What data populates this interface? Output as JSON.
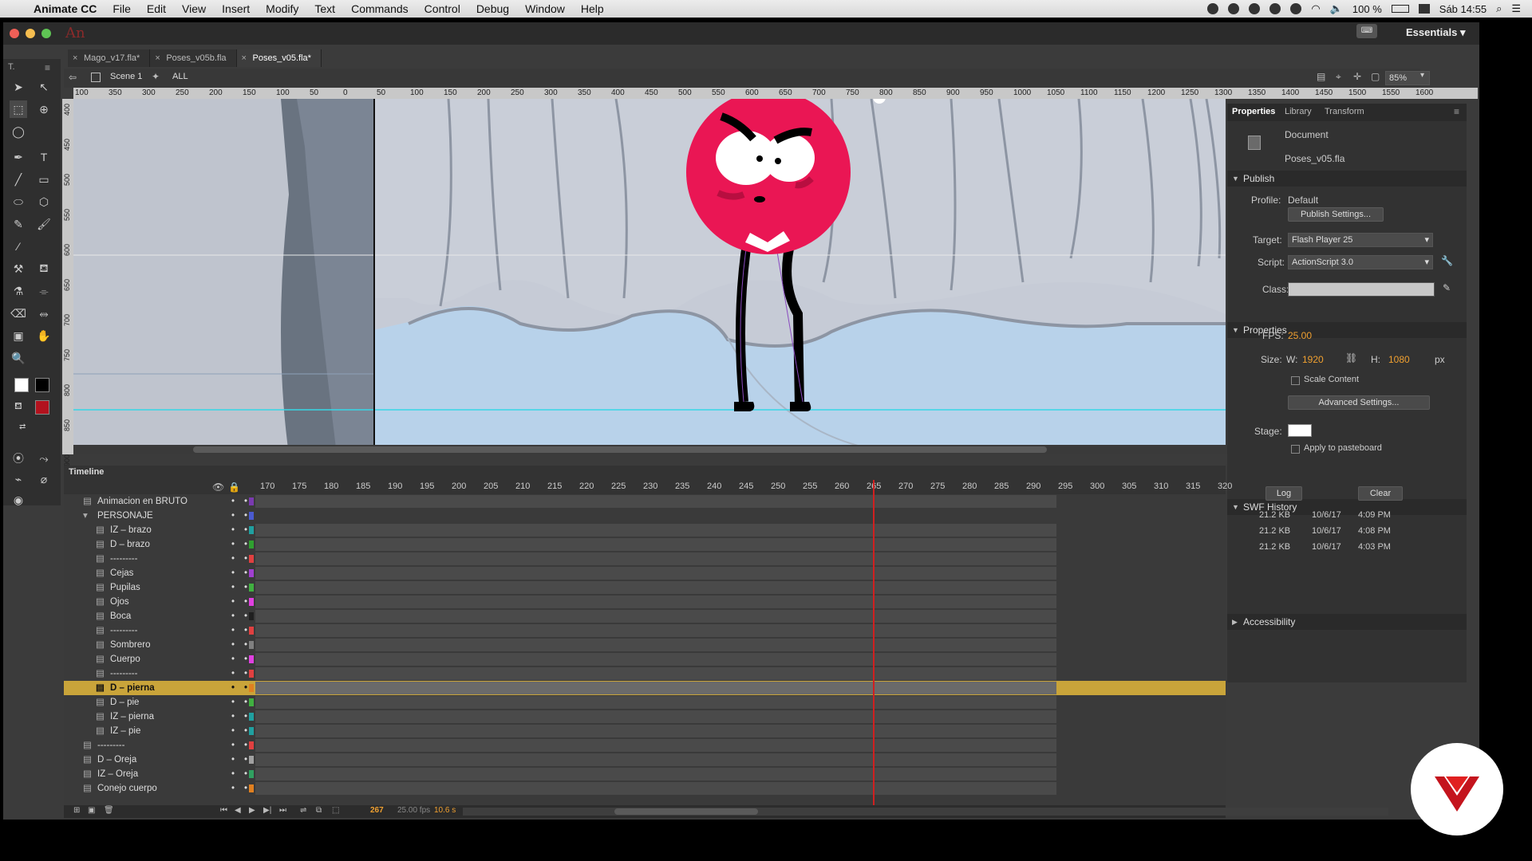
{
  "menubar": {
    "apple": "",
    "app": "Animate CC",
    "items": [
      "File",
      "Edit",
      "View",
      "Insert",
      "Modify",
      "Text",
      "Commands",
      "Control",
      "Debug",
      "Window",
      "Help"
    ],
    "battery": "100 %",
    "clock": "Sáb 14:55"
  },
  "window": {
    "app_logo": "An",
    "workspace": "Essentials",
    "tabs": [
      {
        "label": "Mago_v17.fla*",
        "active": false
      },
      {
        "label": "Poses_v05b.fla",
        "active": false
      },
      {
        "label": "Poses_v05.fla*",
        "active": true
      }
    ],
    "scene": "Scene 1",
    "symbol": "ALL",
    "zoom": "85%"
  },
  "ruler": {
    "top_ticks": [
      "100",
      "350",
      "300",
      "250",
      "200",
      "150",
      "100",
      "50",
      "0",
      "50",
      "100",
      "150",
      "200",
      "250",
      "300",
      "350",
      "400",
      "450",
      "500",
      "550",
      "600",
      "650",
      "700",
      "750",
      "800",
      "850",
      "900",
      "950",
      "1000",
      "1050",
      "1100",
      "1150",
      "1200",
      "1250",
      "1300",
      "1350",
      "1400",
      "1450",
      "1500",
      "1550",
      "1600"
    ],
    "left_ticks": [
      "400",
      "450",
      "500",
      "550",
      "600",
      "650",
      "700",
      "750",
      "800",
      "850",
      "900"
    ]
  },
  "properties": {
    "tabs": [
      "Properties",
      "Library",
      "Transform"
    ],
    "doc_label": "Document",
    "doc_name": "Poses_v05.fla",
    "publish_header": "Publish",
    "profile_label": "Profile:",
    "profile_value": "Default",
    "publish_settings_btn": "Publish Settings...",
    "target_label": "Target:",
    "target_value": "Flash Player 25",
    "script_label": "Script:",
    "script_value": "ActionScript 3.0",
    "class_label": "Class:",
    "props_header": "Properties",
    "fps_label": "FPS:",
    "fps_value": "25.00",
    "size_label": "Size:",
    "w_label": "W:",
    "w_value": "1920",
    "h_label": "H:",
    "h_value": "1080",
    "px": "px",
    "scale_content": "Scale Content",
    "advanced_btn": "Advanced Settings...",
    "stage_label": "Stage:",
    "apply_paste": "Apply to pasteboard",
    "swf_header": "SWF History",
    "log_btn": "Log",
    "clear_btn": "Clear",
    "history": [
      {
        "size": "21.2 KB",
        "date": "10/6/17",
        "time": "4:09 PM"
      },
      {
        "size": "21.2 KB",
        "date": "10/6/17",
        "time": "4:08 PM"
      },
      {
        "size": "21.2 KB",
        "date": "10/6/17",
        "time": "4:03 PM"
      }
    ],
    "accessibility_header": "Accessibility"
  },
  "timeline": {
    "title": "Timeline",
    "frame_numbers": [
      "170",
      "175",
      "180",
      "185",
      "190",
      "195",
      "200",
      "205",
      "210",
      "215",
      "220",
      "225",
      "230",
      "235",
      "240",
      "245",
      "250",
      "255",
      "260",
      "265",
      "270",
      "275",
      "280",
      "285",
      "290",
      "295",
      "300",
      "305",
      "310",
      "315",
      "320"
    ],
    "layers": [
      {
        "name": "Animacion en BRUTO",
        "indent": 0,
        "color": "#7a3ab0",
        "selected": false
      },
      {
        "name": "PERSONAJE",
        "indent": 0,
        "color": "#4a5ad0",
        "selected": false,
        "folder": true
      },
      {
        "name": "IZ – brazo",
        "indent": 1,
        "color": "#20a0a0",
        "selected": false
      },
      {
        "name": "D – brazo",
        "indent": 1,
        "color": "#30a030",
        "selected": false
      },
      {
        "name": "---------",
        "indent": 1,
        "color": "#e04040",
        "selected": false
      },
      {
        "name": "Cejas",
        "indent": 1,
        "color": "#a040d0",
        "selected": false
      },
      {
        "name": "Pupilas",
        "indent": 1,
        "color": "#40b040",
        "selected": false
      },
      {
        "name": "Ojos",
        "indent": 1,
        "color": "#e040e0",
        "selected": false
      },
      {
        "name": "Boca",
        "indent": 1,
        "color": "#202020",
        "selected": false
      },
      {
        "name": "---------",
        "indent": 1,
        "color": "#e04040",
        "selected": false
      },
      {
        "name": "Sombrero",
        "indent": 1,
        "color": "#808080",
        "selected": false
      },
      {
        "name": "Cuerpo",
        "indent": 1,
        "color": "#e040e0",
        "selected": false
      },
      {
        "name": "---------",
        "indent": 1,
        "color": "#e04040",
        "selected": false
      },
      {
        "name": "D – pierna",
        "indent": 1,
        "color": "#e08020",
        "selected": true
      },
      {
        "name": "D – pie",
        "indent": 1,
        "color": "#40b040",
        "selected": false
      },
      {
        "name": "IZ – pierna",
        "indent": 1,
        "color": "#20a0a0",
        "selected": false
      },
      {
        "name": "IZ – pie",
        "indent": 1,
        "color": "#20a0a0",
        "selected": false
      },
      {
        "name": "---------",
        "indent": 0,
        "color": "#e04040",
        "selected": false
      },
      {
        "name": "D – Oreja",
        "indent": 0,
        "color": "#a0a0a0",
        "selected": false
      },
      {
        "name": "IZ – Oreja",
        "indent": 0,
        "color": "#30a060",
        "selected": false
      },
      {
        "name": "Conejo cuerpo",
        "indent": 0,
        "color": "#e08020",
        "selected": false
      }
    ],
    "current_frame": "267",
    "fps": "25.00 fps",
    "time": "10.6 s"
  }
}
